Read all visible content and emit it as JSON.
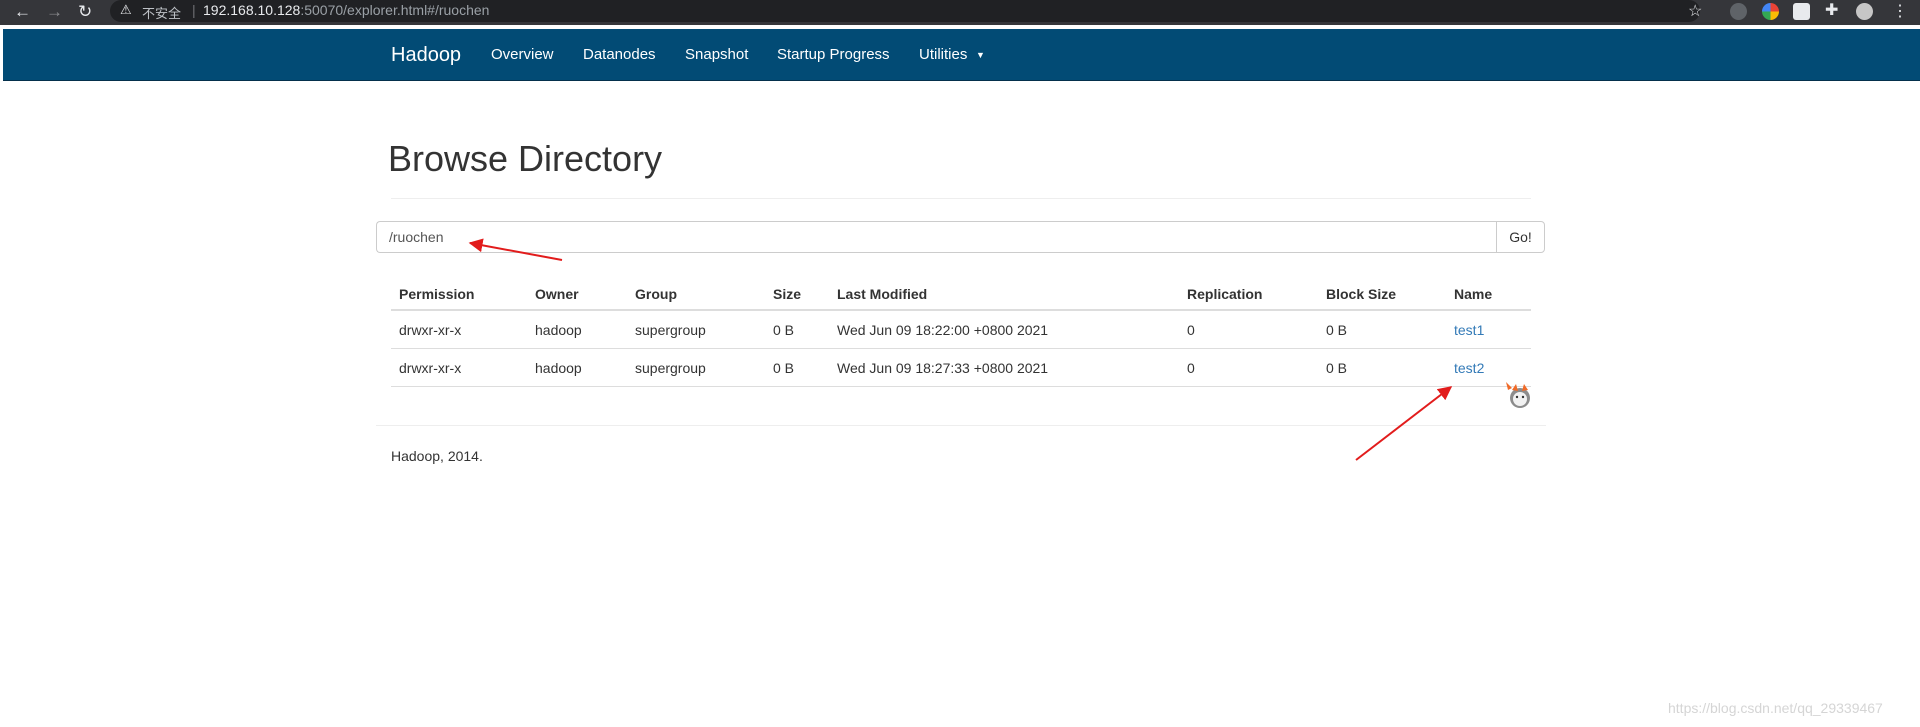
{
  "browser": {
    "insecure_label": "不安全",
    "url_host": "192.168.10.128",
    "url_rest": ":50070/explorer.html#/ruochen"
  },
  "navbar": {
    "brand": "Hadoop",
    "items": [
      {
        "label": "Overview"
      },
      {
        "label": "Datanodes"
      },
      {
        "label": "Snapshot"
      },
      {
        "label": "Startup Progress"
      },
      {
        "label": "Utilities"
      }
    ]
  },
  "main": {
    "title": "Browse Directory",
    "path_input": "/ruochen",
    "go_label": "Go!"
  },
  "table": {
    "headers": [
      "Permission",
      "Owner",
      "Group",
      "Size",
      "Last Modified",
      "Replication",
      "Block Size",
      "Name"
    ],
    "rows": [
      [
        "drwxr-xr-x",
        "hadoop",
        "supergroup",
        "0 B",
        "Wed Jun 09 18:22:00 +0800 2021",
        "0",
        "0 B",
        "test1"
      ],
      [
        "drwxr-xr-x",
        "hadoop",
        "supergroup",
        "0 B",
        "Wed Jun 09 18:27:33 +0800 2021",
        "0",
        "0 B",
        "test2"
      ]
    ]
  },
  "footer": {
    "text": "Hadoop, 2014."
  },
  "watermark": "https://blog.csdn.net/qq_29339467",
  "colors": {
    "navbar": "#024b75",
    "link": "#337ab7",
    "annotation_arrow": "#e21c1c"
  }
}
